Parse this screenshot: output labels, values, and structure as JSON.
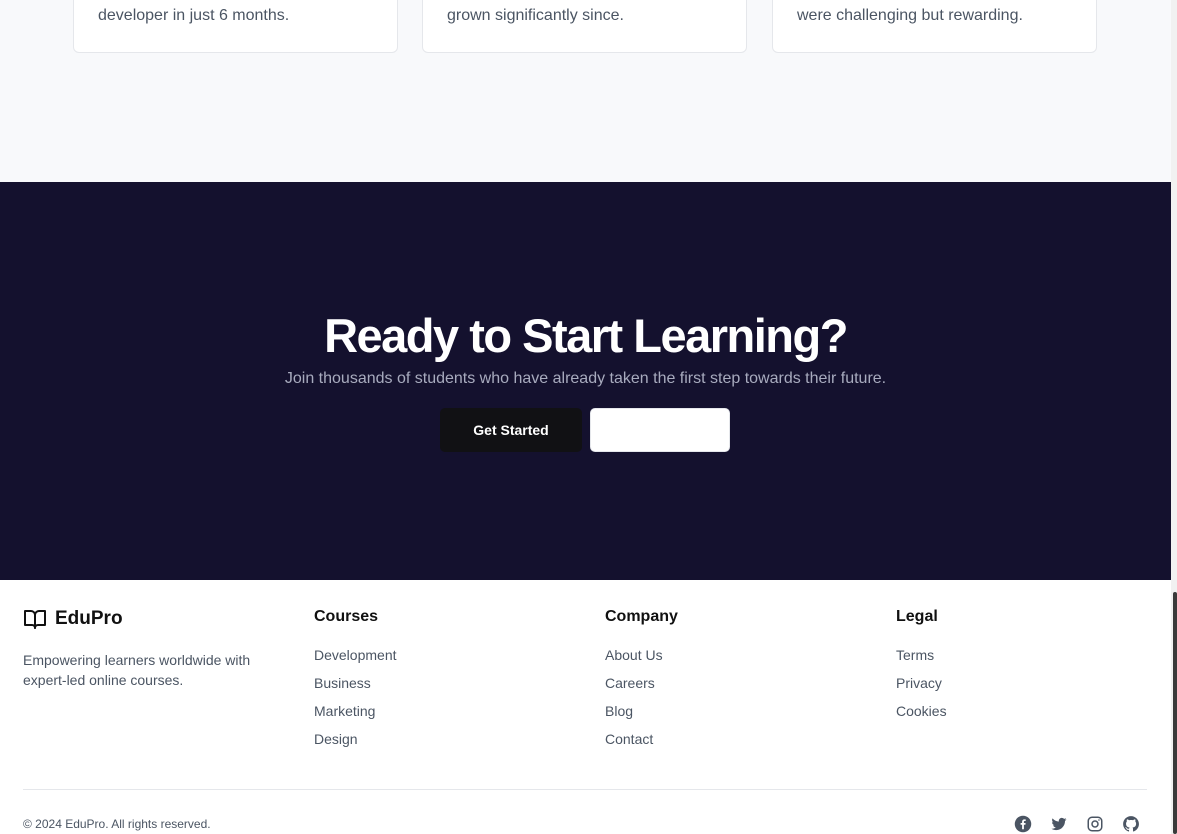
{
  "testimonials": {
    "cards": [
      {
        "text": "developer in just 6 months."
      },
      {
        "text": "grown significantly since."
      },
      {
        "text": "were challenging but rewarding."
      }
    ]
  },
  "cta": {
    "title": "Ready to Start Learning?",
    "subtitle": "Join thousands of students who have already taken the first step towards their future.",
    "primary_label": "Get Started",
    "secondary_label": ""
  },
  "footer": {
    "brand_name": "EduPro",
    "brand_icon": "book-open-icon",
    "description": "Empowering learners worldwide with expert-led online courses.",
    "columns": [
      {
        "title": "Courses",
        "links": [
          "Development",
          "Business",
          "Marketing",
          "Design"
        ]
      },
      {
        "title": "Company",
        "links": [
          "About Us",
          "Careers",
          "Blog",
          "Contact"
        ]
      },
      {
        "title": "Legal",
        "links": [
          "Terms",
          "Privacy",
          "Cookies"
        ]
      }
    ],
    "copyright": "© 2024 EduPro. All rights reserved.",
    "socials": [
      "facebook-icon",
      "twitter-icon",
      "instagram-icon",
      "github-icon"
    ]
  },
  "colors": {
    "cta_bg": "#14112e",
    "primary_button": "#111114",
    "page_bg": "#f8f9fb"
  }
}
